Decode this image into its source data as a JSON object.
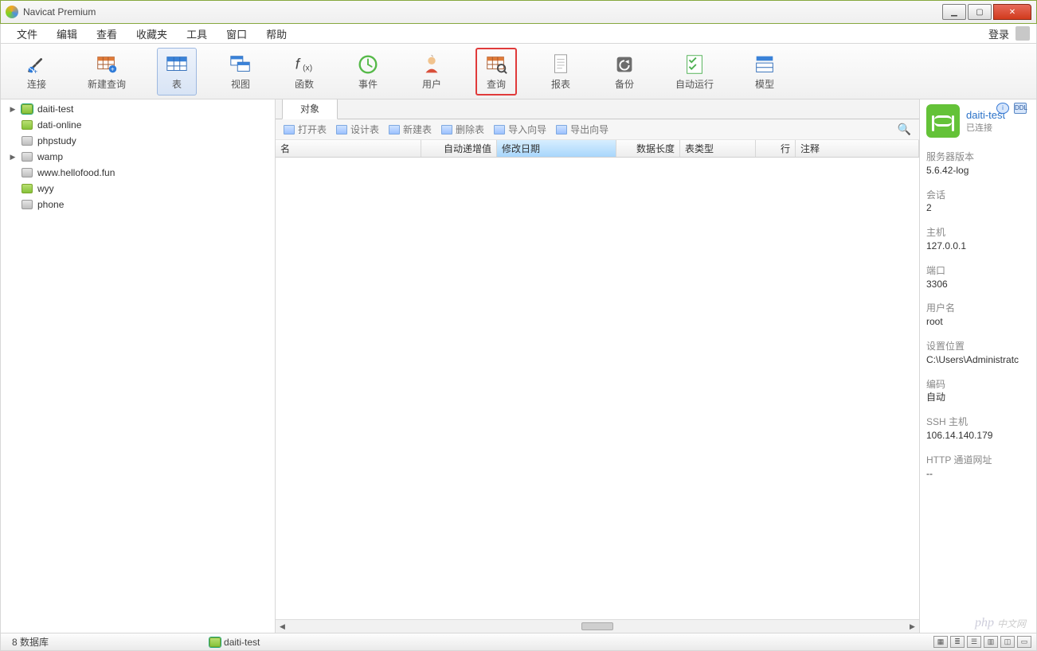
{
  "titlebar": {
    "app": "Navicat Premium"
  },
  "menu": {
    "items": [
      "文件",
      "编辑",
      "查看",
      "收藏夹",
      "工具",
      "窗口",
      "帮助"
    ],
    "login": "登录"
  },
  "toolbar": {
    "items": [
      {
        "id": "connect",
        "label": "连接"
      },
      {
        "id": "newquery",
        "label": "新建查询"
      },
      {
        "id": "table",
        "label": "表",
        "active": true
      },
      {
        "id": "view",
        "label": "视图"
      },
      {
        "id": "func",
        "label": "函数"
      },
      {
        "id": "event",
        "label": "事件"
      },
      {
        "id": "user",
        "label": "用户"
      },
      {
        "id": "query",
        "label": "查询",
        "highlight": true
      },
      {
        "id": "report",
        "label": "报表"
      },
      {
        "id": "backup",
        "label": "备份"
      },
      {
        "id": "autorun",
        "label": "自动运行"
      },
      {
        "id": "model",
        "label": "模型"
      }
    ]
  },
  "tree": [
    {
      "name": "daiti-test",
      "expandable": true,
      "selected": true
    },
    {
      "name": "dati-online"
    },
    {
      "name": "phpstudy",
      "grey": true
    },
    {
      "name": "wamp",
      "expandable": true,
      "grey": true
    },
    {
      "name": "www.hellofood.fun",
      "grey": true
    },
    {
      "name": "wyy"
    },
    {
      "name": "phone",
      "grey": true
    }
  ],
  "tabs": {
    "object": "对象"
  },
  "ops": [
    "打开表",
    "设计表",
    "新建表",
    "删除表",
    "导入向导",
    "导出向导"
  ],
  "columns": {
    "name": "名",
    "auto": "自动递增值",
    "mod": "修改日期",
    "len": "数据长度",
    "tabletype": "表类型",
    "row": "行",
    "comment": "注释"
  },
  "info": {
    "title": "daiti-test",
    "status": "已连接",
    "pairs": [
      {
        "k": "服务器版本",
        "v": "5.6.42-log"
      },
      {
        "k": "会话",
        "v": "2"
      },
      {
        "k": "主机",
        "v": "127.0.0.1"
      },
      {
        "k": "端口",
        "v": "3306"
      },
      {
        "k": "用户名",
        "v": "root"
      },
      {
        "k": "设置位置",
        "v": "C:\\Users\\Administratc"
      },
      {
        "k": "编码",
        "v": "自动"
      },
      {
        "k": "SSH 主机",
        "v": "106.14.140.179"
      },
      {
        "k": "HTTP 通道网址",
        "v": "--"
      }
    ]
  },
  "status": {
    "left": "8 数据库",
    "conn": "daiti-test"
  },
  "watermark": "中文网"
}
